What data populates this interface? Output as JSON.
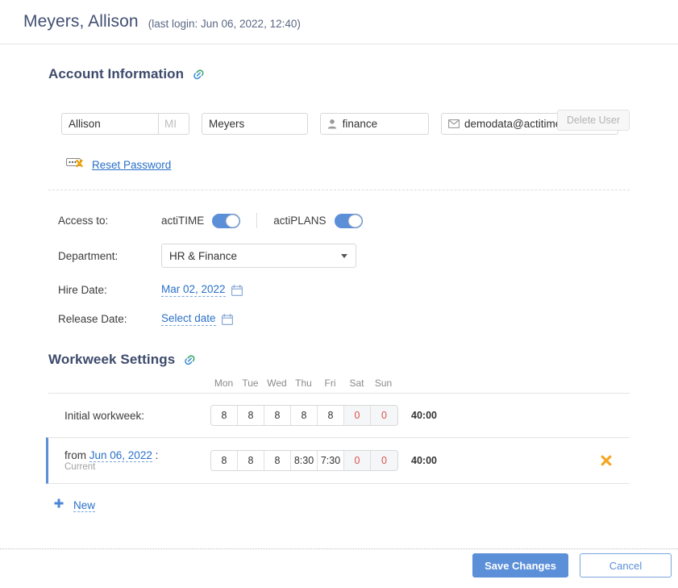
{
  "header": {
    "user_name": "Meyers, Allison",
    "last_login": "(last login: Jun 06, 2022, 12:40)"
  },
  "account_section": {
    "title": "Account Information",
    "link_icon": "link-icon",
    "delete_user_label": "Delete User",
    "fields": {
      "first_name_value": "Allison",
      "middle_initial_placeholder": "MI",
      "middle_initial_value": "",
      "last_name_value": "Meyers",
      "login_value": "finance",
      "login_icon": "user-icon",
      "email_value": "demodata@actitime.com",
      "email_icon": "envelope-icon"
    },
    "reset_password": {
      "icon": "password-reset-icon",
      "label": "Reset Password"
    }
  },
  "settings": {
    "access_label": "Access to:",
    "access_items": [
      {
        "name": "actiTIME",
        "enabled": true
      },
      {
        "name": "actiPLANS",
        "enabled": true
      }
    ],
    "department_label": "Department:",
    "department_value": "HR & Finance",
    "hire_date_label": "Hire Date:",
    "hire_date_value": "Mar 02, 2022",
    "release_date_label": "Release Date:",
    "release_date_value": "Select date",
    "calendar_icon": "calendar-icon"
  },
  "workweek": {
    "title": "Workweek Settings",
    "link_icon": "link-icon",
    "day_headers": [
      "Mon",
      "Tue",
      "Wed",
      "Thu",
      "Fri",
      "Sat",
      "Sun"
    ],
    "rows": [
      {
        "label": "Initial workweek:",
        "label_prefix": "",
        "date": "",
        "sub": "",
        "hours": [
          "8",
          "8",
          "8",
          "8",
          "8",
          "0",
          "0"
        ],
        "weekend_flags": [
          false,
          false,
          false,
          false,
          false,
          true,
          true
        ],
        "total": "40:00",
        "current": false,
        "deletable": false
      },
      {
        "label": "",
        "label_prefix": "from ",
        "date": "Jun 06, 2022",
        "label_suffix": " :",
        "sub": "Current",
        "hours": [
          "8",
          "8",
          "8",
          "8:30",
          "7:30",
          "0",
          "0"
        ],
        "weekend_flags": [
          false,
          false,
          false,
          false,
          false,
          true,
          true
        ],
        "total": "40:00",
        "current": true,
        "deletable": true,
        "delete_icon": "delete-x-icon"
      }
    ],
    "new_label": "New",
    "new_icon": "plus-icon"
  },
  "footer": {
    "save_label": "Save Changes",
    "cancel_label": "Cancel"
  },
  "colors": {
    "accent_blue": "#5b8fd8",
    "link_blue": "#2a70c8",
    "weekend_red": "#d9534f",
    "delete_orange": "#f5a623",
    "title_navy": "#3d4a6b"
  }
}
